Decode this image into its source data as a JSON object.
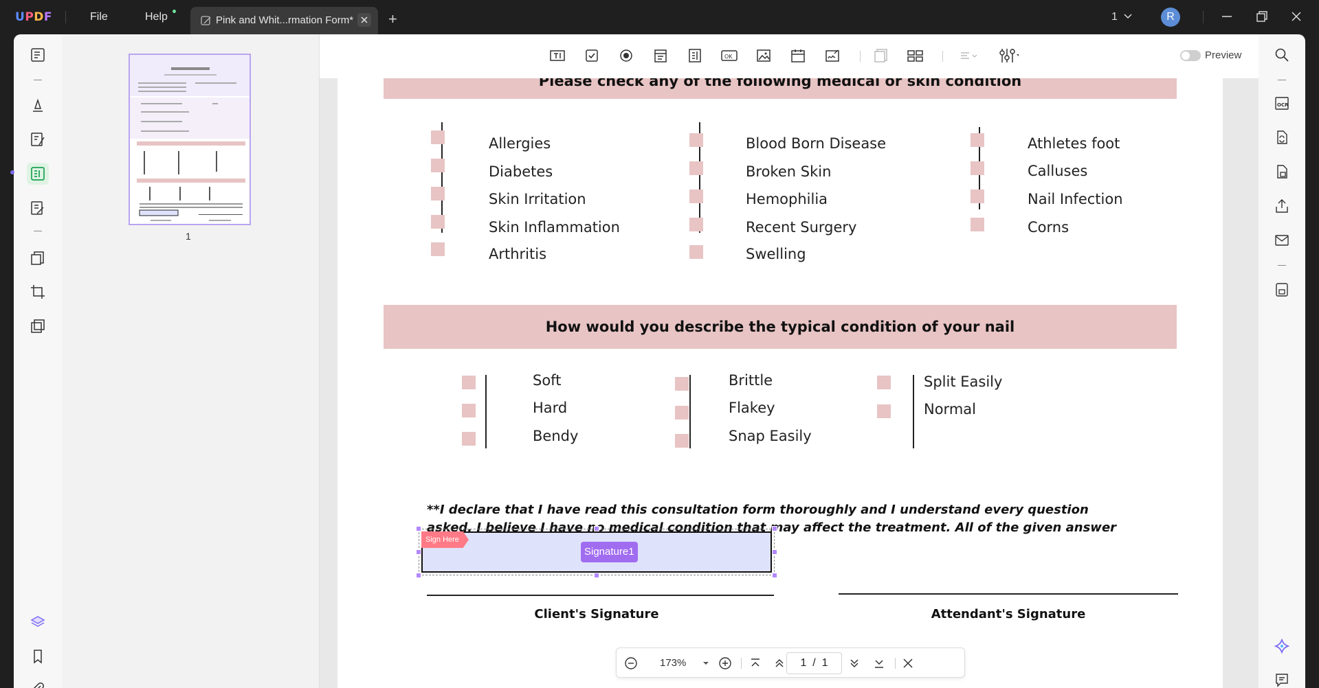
{
  "app": {
    "logo": [
      "U",
      "P",
      "D",
      "F"
    ],
    "menu": {
      "file": "File",
      "help": "Help"
    },
    "tab_title": "Pink and Whit...rmation Form*",
    "page_selector": "1",
    "avatar_initial": "R"
  },
  "thumbnail": {
    "page_number": "1"
  },
  "toolbar": {
    "preview_label": "Preview"
  },
  "document": {
    "section1": {
      "title": "Please check any of the following medical or skin condition",
      "col1": [
        "Allergies",
        "Diabetes",
        "Skin Irritation",
        "Skin Inflammation",
        "Arthritis"
      ],
      "col2": [
        "Blood Born Disease",
        "Broken Skin",
        "Hemophilia",
        "Recent Surgery",
        "Swelling"
      ],
      "col3": [
        "Athletes foot",
        "Calluses",
        "Nail Infection",
        "Corns"
      ]
    },
    "section2": {
      "title": "How would you describe the typical condition of your nail",
      "col1": [
        "Soft",
        "Hard",
        "Bendy"
      ],
      "col2": [
        "Brittle",
        "Flakey",
        "Snap Easily"
      ],
      "col3": [
        "Split Easily",
        "Normal"
      ]
    },
    "declaration": "**I declare that I have read this consultation form thoroughly and I understand every question asked. I believe I have no medical condition that may affect the treatment. All of the given answer is correct and true to the best of my knowledge.",
    "sign_here": "Sign Here",
    "signature_field": "Signature1",
    "client_signature": "Client's Signature",
    "attendant_signature": "Attendant's Signature"
  },
  "zoombar": {
    "zoom": "173%",
    "current_page": "1",
    "separator": "/",
    "total_pages": "1"
  },
  "colors": {
    "band": "#e8c4c4",
    "checkbox": "#e8c4c4",
    "signature_fill": "#dfe2fb",
    "accent": "#a06cf0",
    "sign_here": "#ff7a86"
  }
}
